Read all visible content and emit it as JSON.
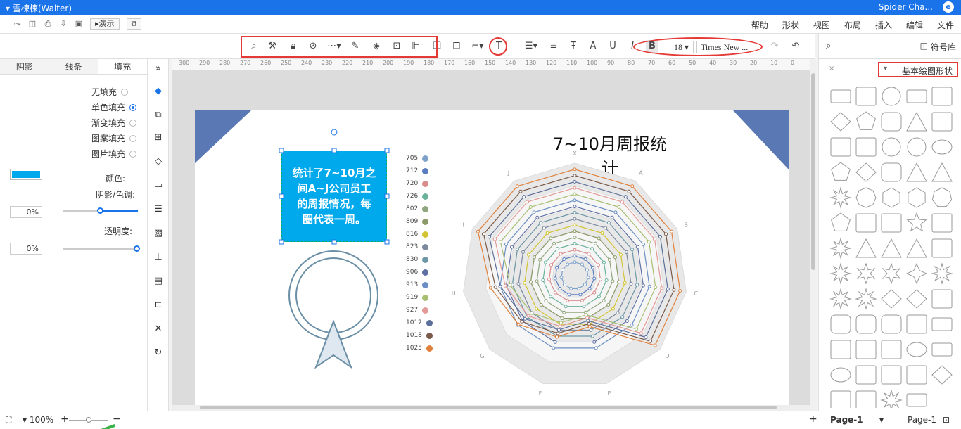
{
  "titlebar": {
    "user": "▾ 雪楝楝(Walter)",
    "app": "Spider Cha..."
  },
  "menu": {
    "items": [
      "文件",
      "编辑",
      "插入",
      "布局",
      "视图",
      "形状",
      "帮助"
    ],
    "present": "演示"
  },
  "toolbar": {
    "font_name": "Times New ...",
    "font_size": "18"
  },
  "left": {
    "tabs": [
      "阴影",
      "线条",
      "填充"
    ],
    "fill_options": [
      "无填充",
      "单色填充",
      "渐变填充",
      "图案填充",
      "图片填充"
    ],
    "selected_fill": "单色填充",
    "color_label": "颜色:",
    "shadow_label": "阴影/色调:",
    "opacity_label": "透明度:",
    "shade_value": "0%",
    "opacity_value": "0%",
    "fill_color": "#00a8ec"
  },
  "ruler": {
    "ticks": [
      "300",
      "290",
      "280",
      "270",
      "260",
      "250",
      "240",
      "230",
      "220",
      "210",
      "200",
      "190",
      "180",
      "170",
      "160",
      "150",
      "140",
      "130",
      "120",
      "110",
      "100",
      "90",
      "80",
      "70",
      "60",
      "50",
      "40",
      "30",
      "20",
      "10",
      "0"
    ]
  },
  "diagram": {
    "title": "7~10月周报统计",
    "textbox": [
      "统计了7~10月之",
      "间A~J公司员工",
      "的周报情况，每",
      "圈代表一周。"
    ],
    "legend": [
      "705",
      "712",
      "720",
      "726",
      "802",
      "809",
      "816",
      "823",
      "830",
      "906",
      "913",
      "919",
      "927",
      "1012",
      "1018",
      "1025"
    ],
    "axes": [
      "X",
      "A",
      "B",
      "C",
      "D",
      "E",
      "F",
      "G",
      "H",
      "I",
      "J"
    ],
    "legend_colors": [
      "#7ea1c9",
      "#5a7dc2",
      "#d88c8c",
      "#6ab39a",
      "#8fa57b",
      "#8b9a66",
      "#d2c430",
      "#7c8aa0",
      "#6b97a6",
      "#5e6fa3",
      "#6b8fc2",
      "#a8bf72",
      "#e39a96",
      "#5b6f9a",
      "#7a5a4a",
      "#e0823e"
    ]
  },
  "right": {
    "title": "符号库",
    "category": "基本绘图形状"
  },
  "status": {
    "page_tab": "Page-1",
    "page_select": "Page-1",
    "zoom": "100%"
  }
}
